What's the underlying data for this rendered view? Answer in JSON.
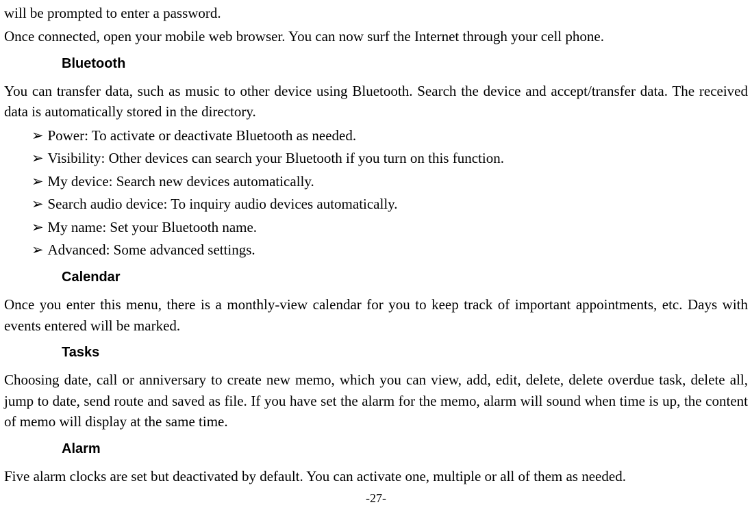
{
  "intro": {
    "line1": "will be prompted to enter a password.",
    "line2": "Once connected, open your mobile web browser. You can now surf the Internet through your cell phone."
  },
  "bluetooth": {
    "heading": "Bluetooth",
    "para": "You can transfer data, such as music to other device using Bluetooth. Search the device and accept/transfer data. The received data is automatically stored in the directory.",
    "items": [
      "Power: To activate or deactivate Bluetooth as needed.",
      "Visibility: Other devices can search your Bluetooth if you turn on this function.",
      "My device: Search new devices automatically.",
      "Search audio device: To inquiry audio devices automatically.",
      "My name: Set your Bluetooth name.",
      "Advanced: Some advanced settings."
    ]
  },
  "calendar": {
    "heading": "Calendar",
    "para": "Once you enter this menu, there is a monthly-view calendar for you to keep track of important appointments, etc. Days with events entered will be marked."
  },
  "tasks": {
    "heading": "Tasks",
    "para": "Choosing date, call or anniversary to create new memo, which you can view, add, edit, delete, delete overdue task, delete all, jump to date, send route and saved as file. If you have set the alarm for the memo, alarm will sound when time is up, the content of memo will display at the same time."
  },
  "alarm": {
    "heading": "Alarm",
    "para": "Five alarm clocks are set but deactivated by default. You can activate one, multiple or all of them as needed."
  },
  "page_number": "-27-"
}
